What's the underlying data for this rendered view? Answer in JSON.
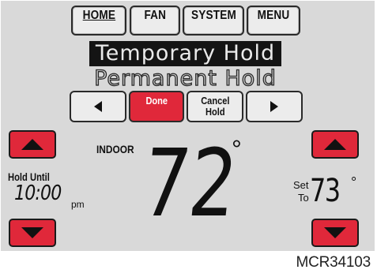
{
  "top_menu": {
    "home": "HOME",
    "fan": "FAN",
    "system": "SYSTEM",
    "menu": "MENU"
  },
  "hold_options": {
    "selected": "Temporary Hold",
    "other": "Permanent Hold"
  },
  "action_row": {
    "done": "Done",
    "cancel_line1": "Cancel",
    "cancel_line2": "Hold"
  },
  "indoor": {
    "label": "INDOOR",
    "temperature": "72",
    "unit": "°"
  },
  "hold_until": {
    "label": "Hold Until",
    "time": "10:00",
    "ampm": "pm"
  },
  "set_to": {
    "label_line1": "Set",
    "label_line2": "To",
    "temperature": "73",
    "unit": "°"
  },
  "model_code": "MCR34103",
  "colors": {
    "screen": "#d9d9d9",
    "accent_red": "#e0283a",
    "button_face": "#ececec"
  }
}
